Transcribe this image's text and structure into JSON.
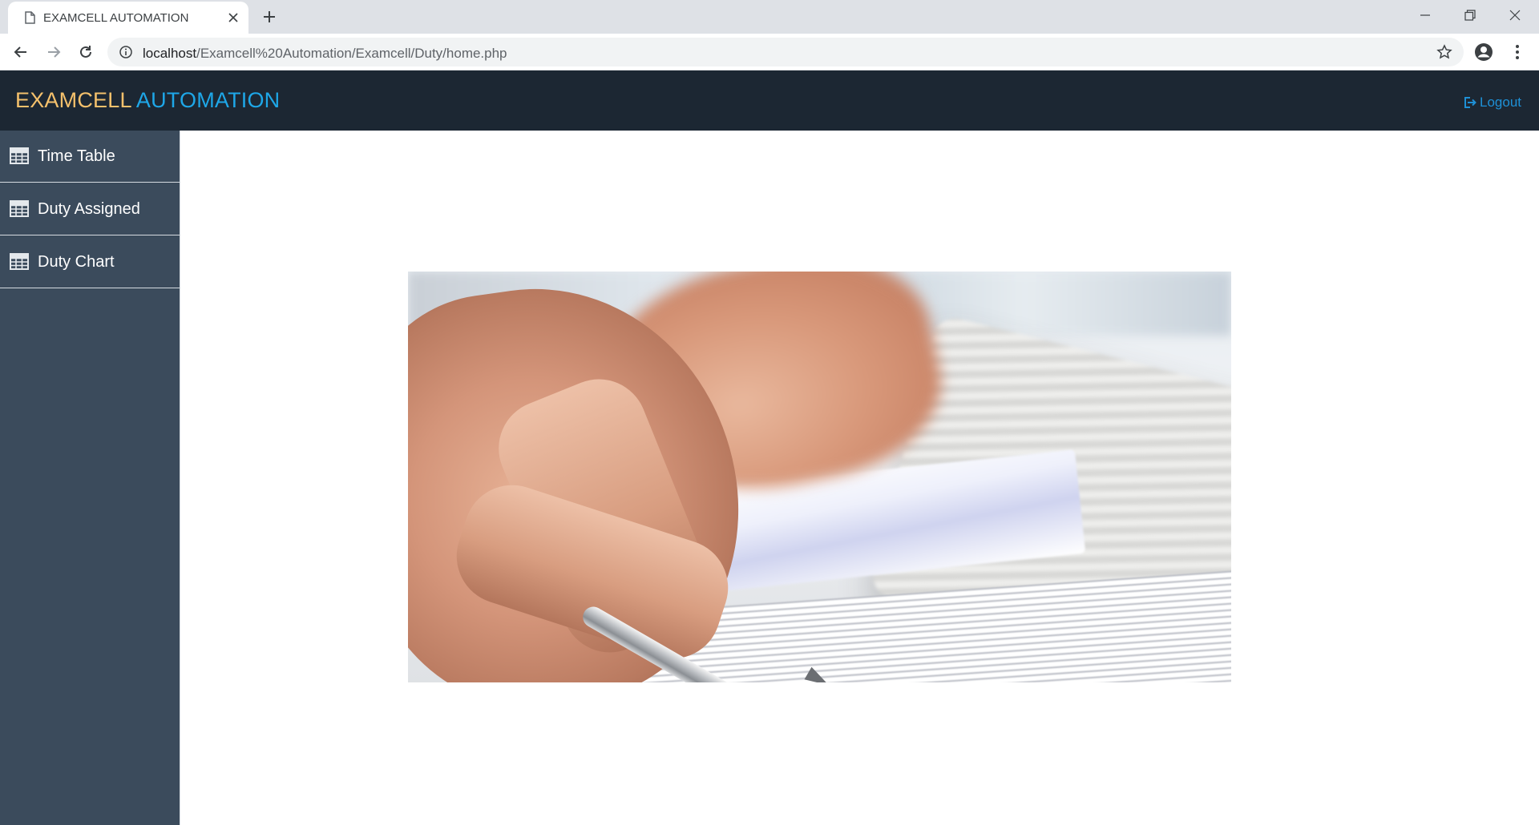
{
  "browser": {
    "tab_title": "EXAMCELL AUTOMATION",
    "url_host": "localhost",
    "url_path": "/Examcell%20Automation/Examcell/Duty/home.php"
  },
  "header": {
    "brand_part1": "EXAMCELL",
    "brand_part2": "AUTOMATION",
    "logout_label": "Logout"
  },
  "sidebar": {
    "items": [
      {
        "label": "Time Table",
        "icon": "table-icon"
      },
      {
        "label": "Duty Assigned",
        "icon": "table-icon"
      },
      {
        "label": "Duty Chart",
        "icon": "table-icon"
      }
    ]
  },
  "colors": {
    "navbar_bg": "#1c2733",
    "sidebar_bg": "#3b4b5c",
    "brand_part1": "#f5c16c",
    "brand_part2": "#1ea7e8",
    "logout": "#1e90d6"
  }
}
